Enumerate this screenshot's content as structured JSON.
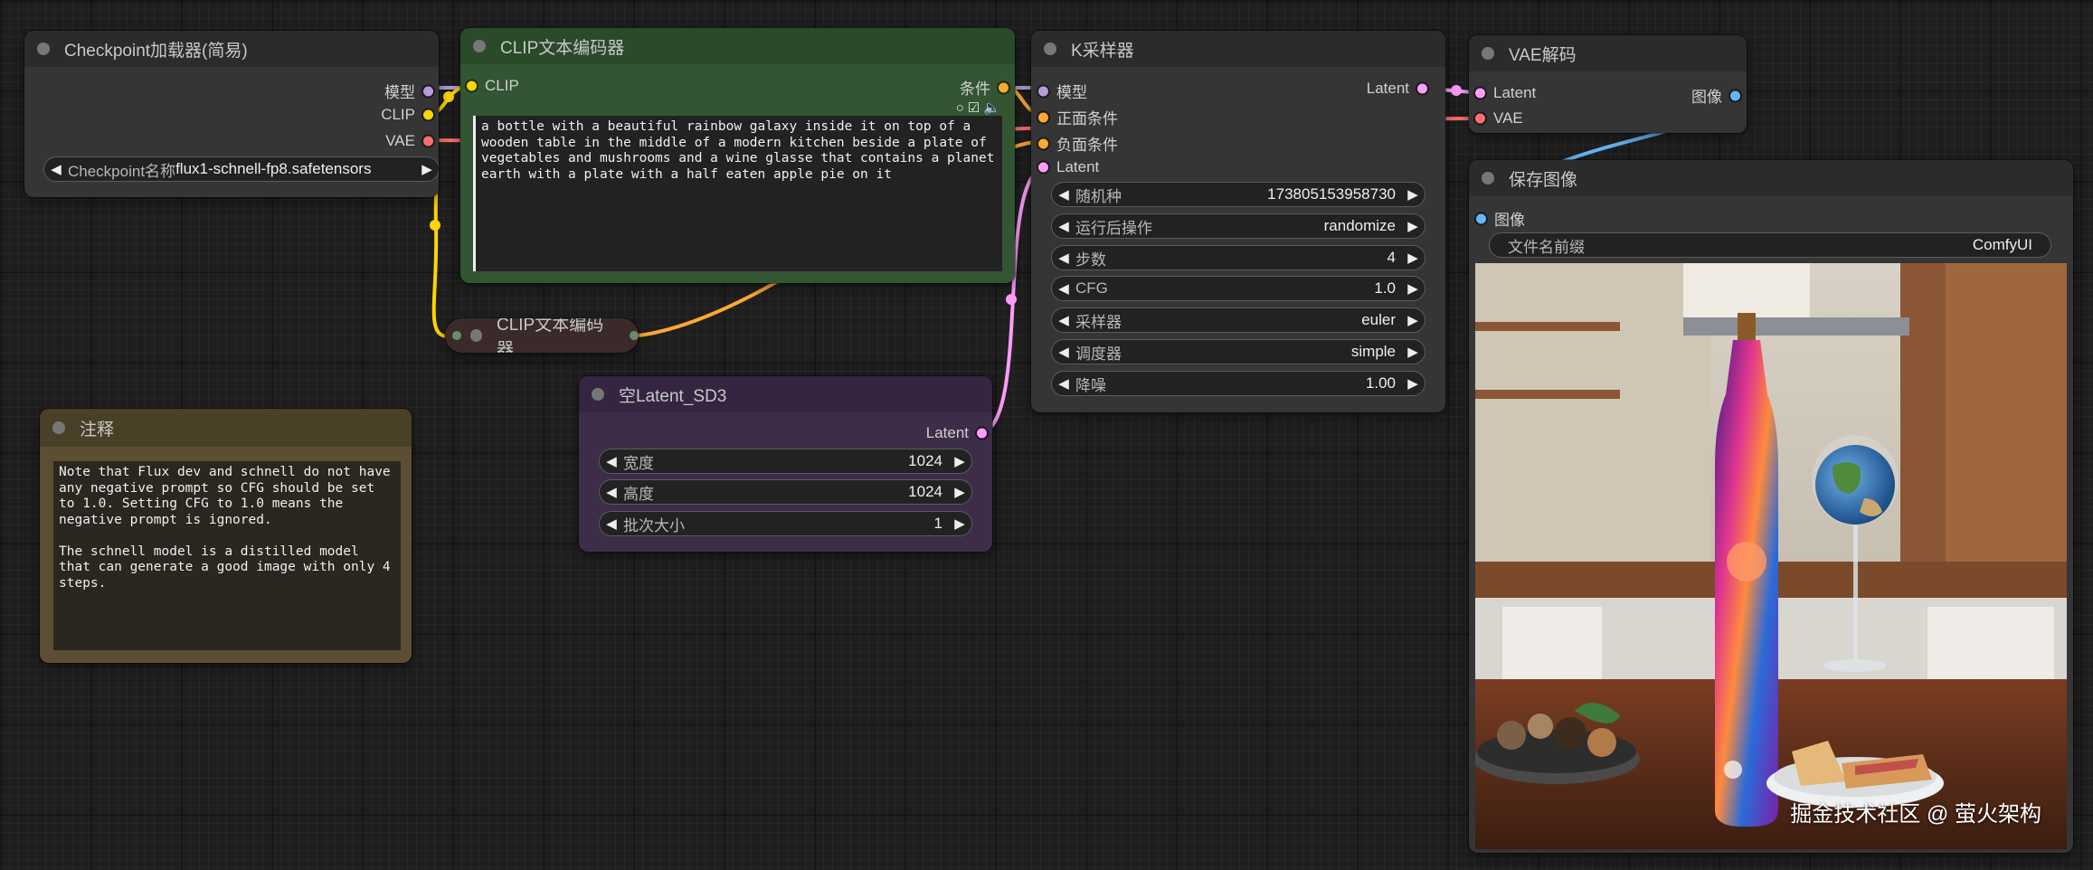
{
  "colors": {
    "model": "#b39ddb",
    "clip": "#ffd500",
    "vae": "#ff6e6e",
    "conditioning": "#ffa931",
    "latent": "#ff9cf9",
    "image": "#64b5f6"
  },
  "checkpoint_loader": {
    "title": "Checkpoint加载器(简易)",
    "outputs": [
      "模型",
      "CLIP",
      "VAE"
    ],
    "widget_label": "Checkpoint名称",
    "widget_value": "flux1-schnell-fp8.safetensors"
  },
  "clip_encoder_pos": {
    "title": "CLIP文本编码器",
    "input": "CLIP",
    "output": "条件",
    "text": "a bottle with a beautiful rainbow galaxy inside it on top of a wooden table in the middle of a modern kitchen beside a plate of vegetables and mushrooms and a wine glasse that contains a planet earth with a plate with a half eaten apple pie on it"
  },
  "clip_encoder_neg": {
    "title": "CLIP文本编码器"
  },
  "note": {
    "title": "注释",
    "text": "Note that Flux dev and schnell do not have any negative prompt so CFG should be set to 1.0. Setting CFG to 1.0 means the negative prompt is ignored.\n\nThe schnell model is a distilled model that can generate a good image with only 4 steps."
  },
  "empty_latent": {
    "title": "空Latent_SD3",
    "output": "Latent",
    "widgets": [
      {
        "label": "宽度",
        "value": "1024"
      },
      {
        "label": "高度",
        "value": "1024"
      },
      {
        "label": "批次大小",
        "value": "1"
      }
    ]
  },
  "ksampler": {
    "title": "K采样器",
    "inputs": [
      "模型",
      "正面条件",
      "负面条件",
      "Latent"
    ],
    "output": "Latent",
    "widgets": [
      {
        "label": "随机种",
        "value": "173805153958730"
      },
      {
        "label": "运行后操作",
        "value": "randomize"
      },
      {
        "label": "步数",
        "value": "4"
      },
      {
        "label": "CFG",
        "value": "1.0"
      },
      {
        "label": "采样器",
        "value": "euler"
      },
      {
        "label": "调度器",
        "value": "simple"
      },
      {
        "label": "降噪",
        "value": "1.00"
      }
    ]
  },
  "vae_decode": {
    "title": "VAE解码",
    "inputs": [
      "Latent",
      "VAE"
    ],
    "output": "图像"
  },
  "save_image": {
    "title": "保存图像",
    "input": "图像",
    "widget_label": "文件名前缀",
    "widget_value": "ComfyUI",
    "watermark": "掘金技术社区 @ 萤火架构"
  }
}
